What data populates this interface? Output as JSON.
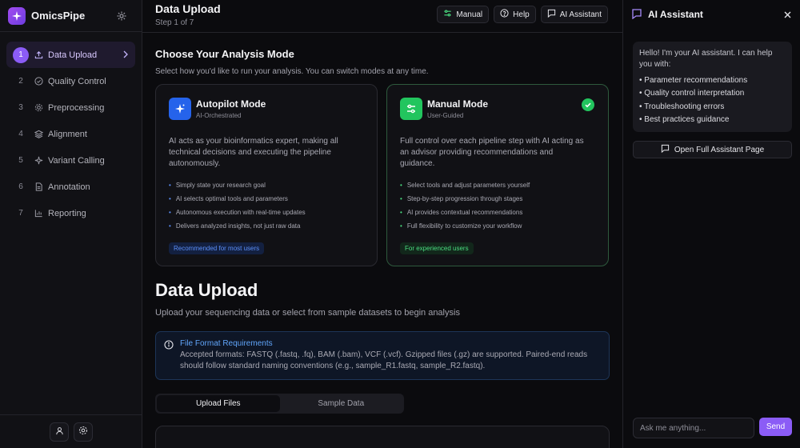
{
  "app": {
    "name": "OmicsPipe"
  },
  "sidebar": {
    "steps": [
      {
        "num": "1",
        "label": "Data Upload",
        "icon": "upload-icon",
        "active": true
      },
      {
        "num": "2",
        "label": "Quality Control",
        "icon": "check-circle-icon"
      },
      {
        "num": "3",
        "label": "Preprocessing",
        "icon": "gear-icon"
      },
      {
        "num": "4",
        "label": "Alignment",
        "icon": "layers-icon"
      },
      {
        "num": "5",
        "label": "Variant Calling",
        "icon": "sparkle-icon"
      },
      {
        "num": "6",
        "label": "Annotation",
        "icon": "document-icon"
      },
      {
        "num": "7",
        "label": "Reporting",
        "icon": "bar-chart-icon"
      }
    ]
  },
  "header": {
    "title": "Data Upload",
    "subtitle": "Step 1 of 7",
    "actions": {
      "manual": "Manual",
      "help": "Help",
      "assistant": "AI Assistant"
    }
  },
  "analysis_mode": {
    "title": "Choose Your Analysis Mode",
    "description": "Select how you'd like to run your analysis. You can switch modes at any time.",
    "modes": [
      {
        "title": "Autopilot Mode",
        "subtitle": "AI-Orchestrated",
        "description": "AI acts as your bioinformatics expert, making all technical decisions and executing the pipeline autonomously.",
        "features": [
          "Simply state your research goal",
          "AI selects optimal tools and parameters",
          "Autonomous execution with real-time updates",
          "Delivers analyzed insights, not just raw data"
        ],
        "tag": "Recommended for most users",
        "accent": "#2563eb"
      },
      {
        "title": "Manual Mode",
        "subtitle": "User-Guided",
        "description": "Full control over each pipeline step with AI acting as an advisor providing recommendations and guidance.",
        "features": [
          "Select tools and adjust parameters yourself",
          "Step-by-step progression through stages",
          "AI provides contextual recommendations",
          "Full flexibility to customize your workflow"
        ],
        "tag": "For experienced users",
        "accent": "#22c55e",
        "selected": true
      }
    ]
  },
  "upload": {
    "title": "Data Upload",
    "subtitle": "Upload your sequencing data or select from sample datasets to begin analysis",
    "info": {
      "title": "File Format Requirements",
      "text": "Accepted formats: FASTQ (.fastq, .fq), BAM (.bam), VCF (.vcf). Gzipped files (.gz) are supported. Paired-end reads should follow standard naming conventions (e.g., sample_R1.fastq, sample_R2.fastq)."
    },
    "tabs": [
      {
        "label": "Upload Files",
        "active": true
      },
      {
        "label": "Sample Data"
      }
    ]
  },
  "assistant": {
    "title": "AI Assistant",
    "greeting": "Hello! I'm your AI assistant. I can help you with:",
    "items": [
      "• Parameter recommendations",
      "• Quality control interpretation",
      "• Troubleshooting errors",
      "• Best practices guidance"
    ],
    "open_page": "Open Full Assistant Page",
    "input_placeholder": "Ask me anything...",
    "send": "Send"
  },
  "colors": {
    "brand": "#8b5cf6",
    "info": "#60a5fa",
    "success": "#22c55e"
  }
}
